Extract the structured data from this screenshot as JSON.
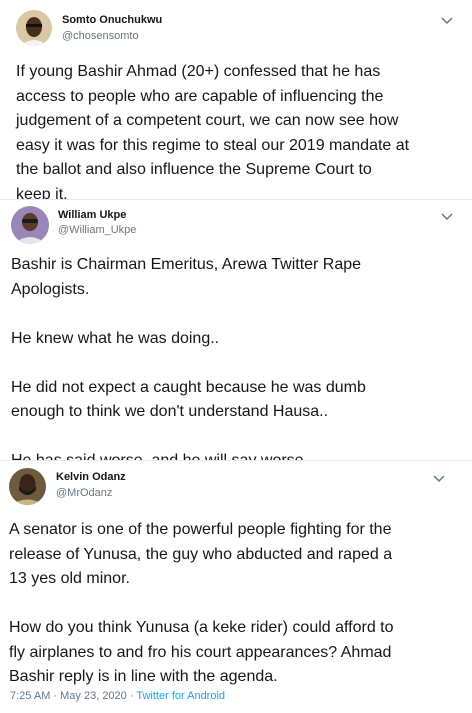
{
  "tweets": [
    {
      "name": "Somto Onuchukwu",
      "handle": "@chosensomto",
      "lines": [
        "If young Bashir Ahmad (20+) confessed that he has",
        "access to people who are capable of influencing the",
        "judgement of a competent court, we can now see how",
        "easy it was for this regime to steal our 2019 mandate at",
        "the ballot and also influence the Supreme Court to",
        "keep it."
      ]
    },
    {
      "name": "William Ukpe",
      "handle": "@William_Ukpe",
      "lines": [
        "Bashir is Chairman Emeritus, Arewa Twitter Rape",
        "Apologists.",
        "",
        "He knew what he was doing..",
        "",
        "He did not expect a caught because he was dumb",
        "enough to think we don't understand Hausa..",
        "",
        "He has said worse, and he will say worse.."
      ]
    },
    {
      "name": "Kelvin Odanz",
      "handle": "@MrOdanz",
      "lines": [
        "A senator is one of the powerful people fighting for the",
        "release of Yunusa, the guy who abducted and raped a",
        "13 yes old minor.",
        "",
        "How do you think Yunusa (a keke rider) could afford to",
        "fly airplanes to and fro his court appearances? Ahmad",
        "Bashir reply is in line with the agenda."
      ],
      "time": "7:25 AM · May 23, 2020 · ",
      "source": "Twitter for Android"
    }
  ],
  "icons": {
    "caret": "chevron-down-icon",
    "avatar": "avatar"
  }
}
